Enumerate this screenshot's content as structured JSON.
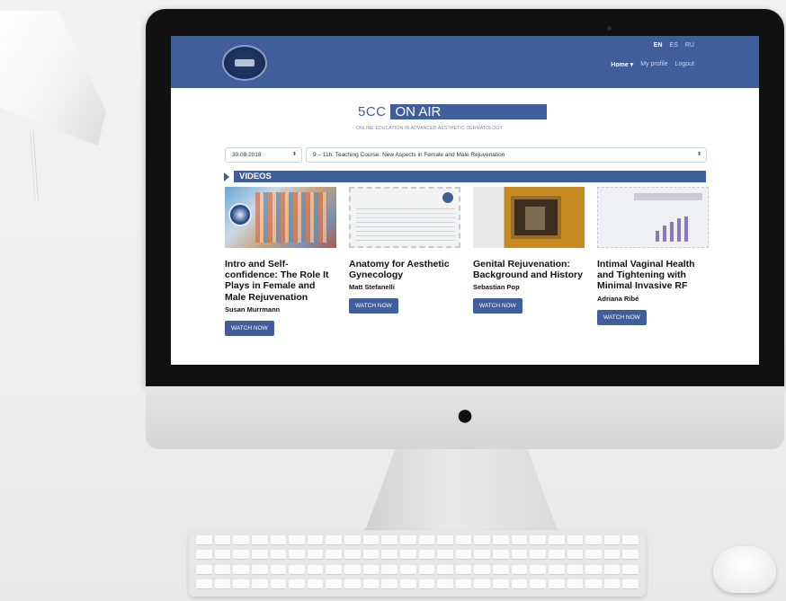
{
  "site": {
    "languages": [
      "EN",
      "ES",
      "RU"
    ],
    "active_language": "EN",
    "nav": {
      "home": "Home",
      "home_caret": "▾",
      "my_profile": "My profile",
      "logout": "Logout"
    },
    "brand_prefix": "5CC",
    "brand_main": "ON AIR",
    "tagline": "ONLINE EDUCATION IN ADVANCED AESTHETIC DERMATOLOGY",
    "date_select": "30.08.2018",
    "session_select": "9 – 11h: Teaching Course: New Aspects in Female and Male Rejuvenation",
    "videos_heading": "VIDEOS",
    "videos": [
      {
        "title": "Intro and Self-confidence: The Role It Plays in Female and Male Rejuvenation",
        "speaker": "Susan Murrmann",
        "button": "WATCH NOW"
      },
      {
        "title": "Anatomy for Aesthetic Gynecology",
        "speaker": "Matt Stefanelli",
        "button": "WATCH NOW"
      },
      {
        "title": "Genital Rejuvenation: Background and History",
        "speaker": "Sebastian Pop",
        "button": "WATCH NOW"
      },
      {
        "title": "Intimal Vaginal Health and Tightening with Minimal Invasive RF",
        "speaker": "Adriana Ribé",
        "button": "WATCH NOW"
      }
    ],
    "colors": {
      "brand_blue": "#3f5e9a",
      "text": "#111111"
    }
  },
  "icons": {
    "select_arrow": "⬍",
    "apple_logo": ""
  }
}
